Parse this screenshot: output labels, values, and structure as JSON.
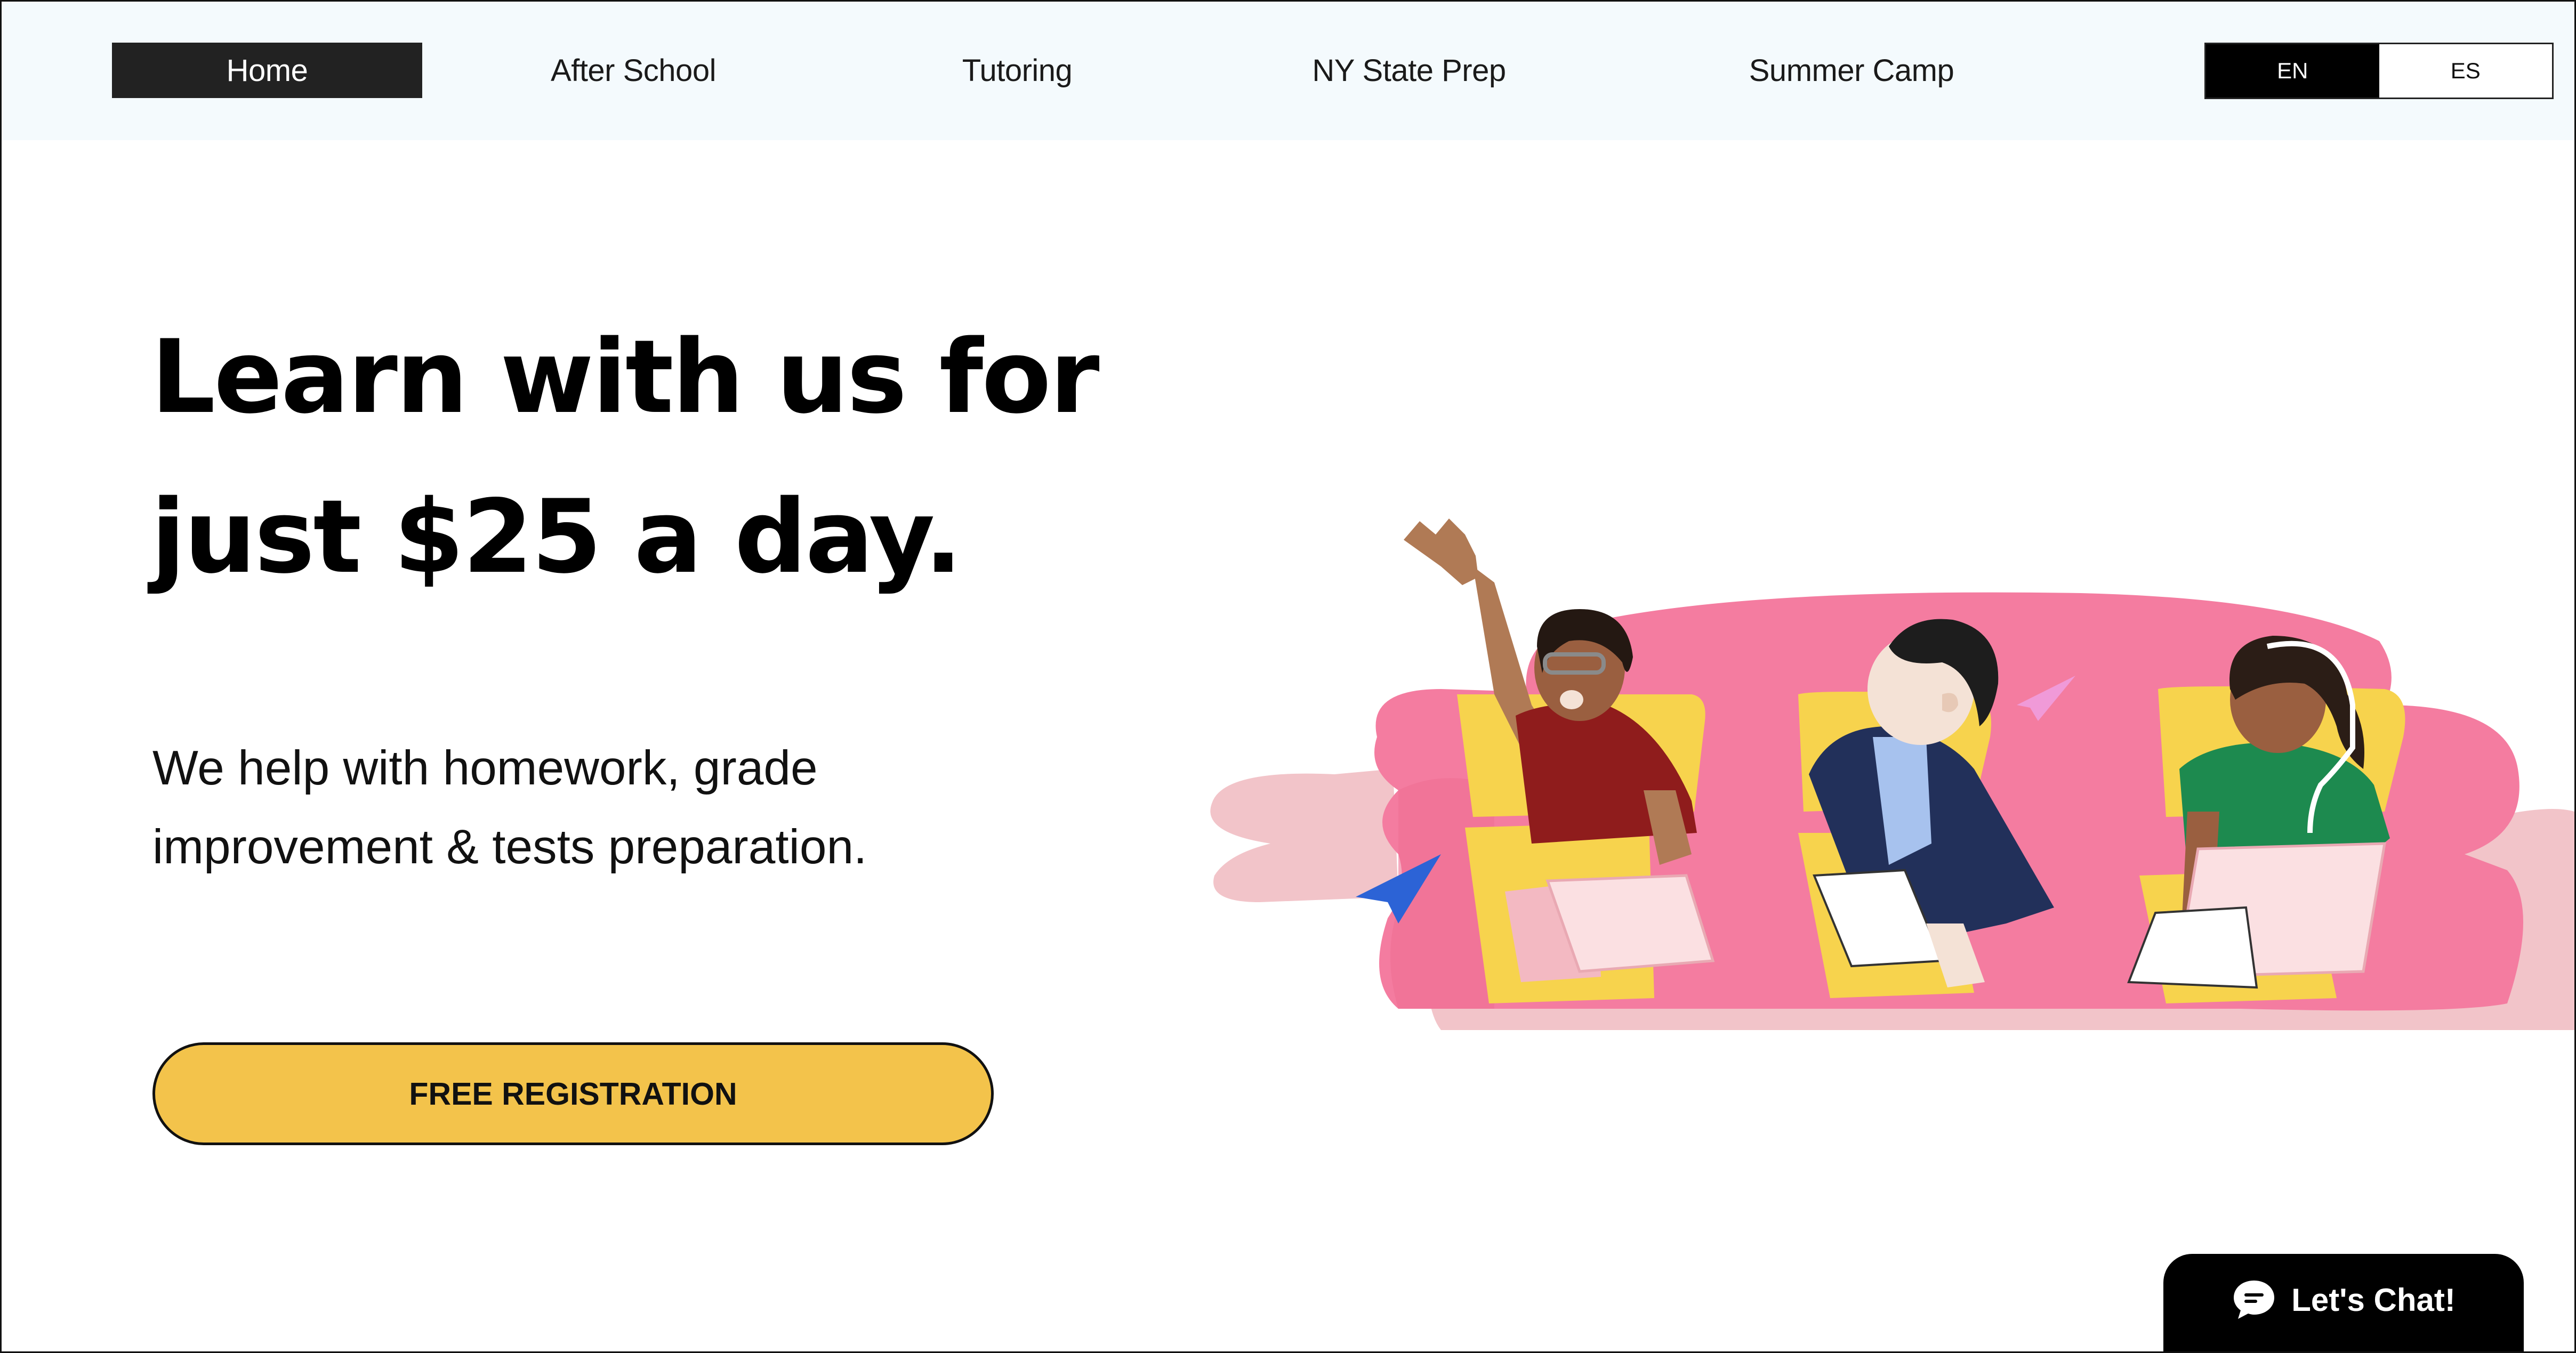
{
  "nav": {
    "items": [
      {
        "label": "Home",
        "active": true
      },
      {
        "label": "After School",
        "active": false
      },
      {
        "label": "Tutoring",
        "active": false
      },
      {
        "label": "NY State Prep",
        "active": false
      },
      {
        "label": "Summer Camp",
        "active": false
      }
    ],
    "languages": [
      {
        "label": "EN",
        "active": true
      },
      {
        "label": "ES",
        "active": false
      }
    ]
  },
  "hero": {
    "headline_line1": "Learn with us for",
    "headline_line2": "just $25 a day.",
    "subtext_line1": "We help with homework, grade",
    "subtext_line2": "improvement & tests preparation.",
    "cta_label": "FREE REGISTRATION"
  },
  "chat": {
    "label": "Let's Chat!",
    "icon": "chat-bubble-icon"
  },
  "colors": {
    "cta": "#f3c34b",
    "nav_bg": "#f4fafd",
    "nav_active": "#222222",
    "blob_pink": "#f47ca0",
    "blob_light": "#f2c4c9",
    "chair_yellow": "#f7d34d"
  },
  "illustration": {
    "name": "three-students-at-desks-illustration",
    "icons": [
      "paper-plane-icon"
    ]
  }
}
